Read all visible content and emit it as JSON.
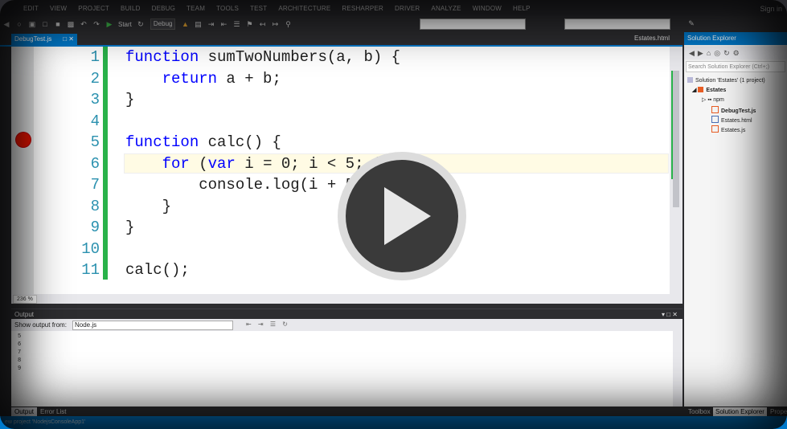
{
  "menu": {
    "items": [
      "EDIT",
      "VIEW",
      "PROJECT",
      "BUILD",
      "DEBUG",
      "TEAM",
      "TOOLS",
      "TEST",
      "ARCHITECTURE",
      "RESHARPER",
      "DRIVER",
      "ANALYZE",
      "WINDOW",
      "HELP"
    ],
    "signin": "Sign in"
  },
  "toolbar": {
    "start_label": "Start",
    "config_value": "Debug"
  },
  "tabs": {
    "active": "DebugTest.js",
    "right": "Estates.html"
  },
  "editor": {
    "lines": [
      {
        "num": "1",
        "code": "function sumTwoNumbers(a, b) {"
      },
      {
        "num": "2",
        "code": "    return a + b;"
      },
      {
        "num": "3",
        "code": "}"
      },
      {
        "num": "4",
        "code": ""
      },
      {
        "num": "5",
        "code": "function calc() {"
      },
      {
        "num": "6",
        "code": "    for (var i = 0; i < 5; i"
      },
      {
        "num": "7",
        "code": "        console.log(i + 5"
      },
      {
        "num": "8",
        "code": "    }"
      },
      {
        "num": "9",
        "code": "}"
      },
      {
        "num": "10",
        "code": ""
      },
      {
        "num": "11",
        "code": "calc();"
      }
    ],
    "zoom": "236 %"
  },
  "output": {
    "title": "Output",
    "show_from_label": "Show output from:",
    "source_value": "Node.js",
    "lines": [
      "5",
      "6",
      "7",
      "8",
      "9"
    ]
  },
  "bottom_tabs": [
    "Output",
    "Error List"
  ],
  "solution_explorer": {
    "title": "Solution Explorer",
    "search_placeholder": "Search Solution Explorer (Ctrl+;)",
    "solution": "Solution 'Estates' (1 project)",
    "project": "Estates",
    "nodes": [
      "npm",
      "DebugTest.js",
      "Estates.html",
      "Estates.js"
    ],
    "bottom_tabs": [
      "Toolbox",
      "Solution Explorer",
      "Prope"
    ]
  },
  "status": "ew project 'NodejsConsoleApp1'",
  "colors": {
    "accent": "#007acc",
    "keyword": "#0000ff",
    "linenum": "#2b91af",
    "breakpoint": "#e51400",
    "changebar": "#29b24a"
  }
}
